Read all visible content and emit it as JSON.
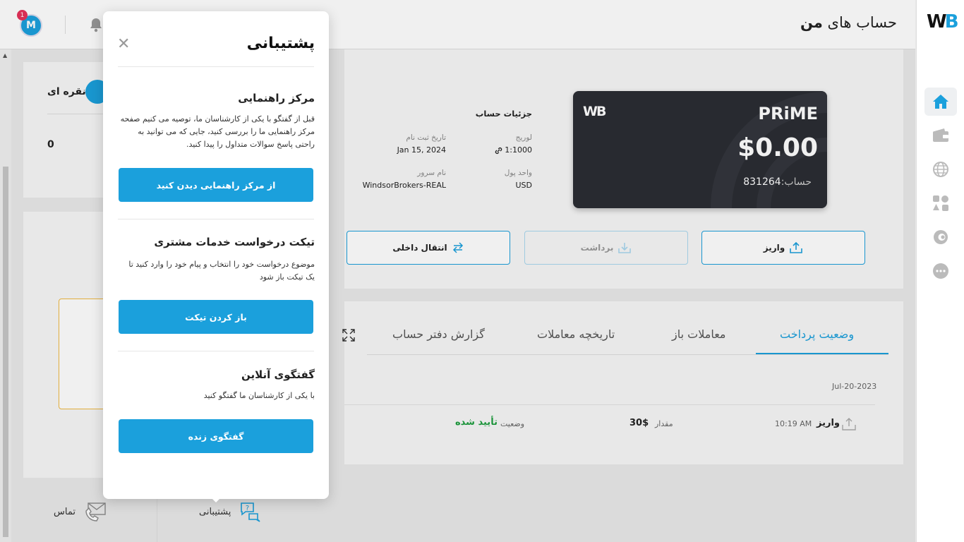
{
  "app": {
    "logo_w": "W",
    "logo_b": "B"
  },
  "header": {
    "title_regular": "حساب های",
    "title_bold": "من",
    "avatar_initial": "M",
    "notification_count": "1"
  },
  "sidebar": {
    "items": [
      {
        "name": "home",
        "icon": "home-icon",
        "active": true
      },
      {
        "name": "wallet",
        "icon": "wallet-icon",
        "active": false
      },
      {
        "name": "globe",
        "icon": "globe-icon",
        "active": false
      },
      {
        "name": "apps",
        "icon": "apps-icon",
        "active": false
      },
      {
        "name": "copy",
        "icon": "copytrade-icon",
        "active": false
      },
      {
        "name": "more",
        "icon": "more-icon",
        "active": false
      }
    ]
  },
  "account_card": {
    "type": "PRiME",
    "balance": "$0.00",
    "account_label": "حساب:",
    "account_number": "831264",
    "logo": "WB"
  },
  "details": {
    "title": "جزئیات حساب",
    "leverage_label": "لوریج",
    "leverage_value": "1:1000",
    "registered_label": "تاریخ ثبت نام",
    "registered_value": "Jan 15, 2024",
    "currency_label": "واحد پول",
    "currency_value": "USD",
    "server_label": "نام سرور",
    "server_value": "WindsorBrokers-REAL"
  },
  "actions": {
    "deposit": "واریز",
    "withdraw": "برداشت",
    "transfer": "انتقال داخلی"
  },
  "tabs": {
    "payment_status": "وضعیت پرداخت",
    "open_trades": "معاملات باز",
    "trade_history": "تاریخچه معاملات",
    "ledger_report": "گزارش دفتر حساب"
  },
  "transactions": {
    "date": "Jul-20-2023",
    "rows": [
      {
        "type": "واریز",
        "time": "10:19 AM",
        "amount_label": "مقدار",
        "amount": "30$",
        "status_label": "وضعیت",
        "status": "تأیید شده"
      }
    ]
  },
  "left_panel": {
    "silver_label": "نقره ای",
    "silver_value": "0"
  },
  "bottom": {
    "support": "پشتیبانی",
    "contact": "تماس"
  },
  "popup": {
    "title": "پشتیبانی",
    "sections": [
      {
        "title": "مرکز راهنمایی",
        "desc": "قبل از گفتگو با یکی از کارشناسان ما، توصیه می کنیم صفحه مرکز راهنمایی ما را بررسی کنید، جایی که می توانید به راحتی پاسخ سوالات متداول را پیدا کنید.",
        "button": "از مرکز راهنمایی دیدن کنید"
      },
      {
        "title": "تیکت درخواست خدمات مشتری",
        "desc": "موضوع درخواست خود را انتخاب و پیام خود را وارد کنید تا یک تیکت باز شود",
        "button": "باز کردن تیکت"
      },
      {
        "title": "گفتگوی آنلاین",
        "desc": "با یکی از کارشناسان ما گفتگو کنید",
        "button": "گفتگوی زنده"
      }
    ]
  },
  "colors": {
    "accent": "#1ba0dc",
    "success": "#1e9e3f",
    "card_dark": "#2b2d33",
    "warning_border": "#f0b840"
  }
}
